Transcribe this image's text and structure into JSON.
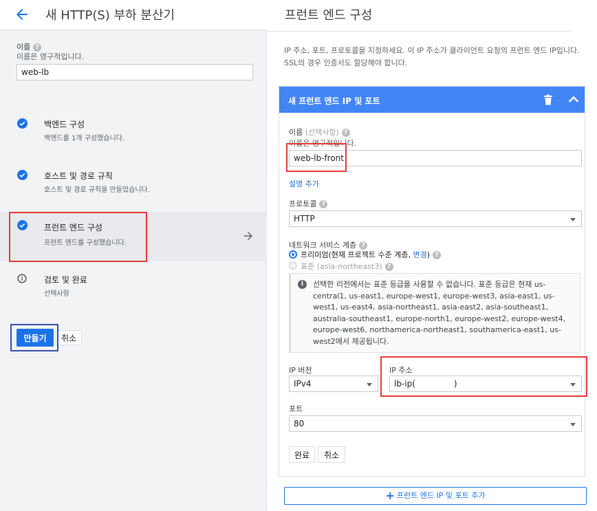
{
  "header": {
    "title": "새 HTTP(S) 부하 분산기"
  },
  "lb_name": {
    "label": "이름",
    "sublabel": "이름은 영구적입니다.",
    "value": "web-lb"
  },
  "steps": [
    {
      "title": "백엔드 구성",
      "description": "백엔드를 1개 구성했습니다."
    },
    {
      "title": "호스트 및 경로 규칙",
      "description": "호스트 및 경로 규칙을 만들었습니다."
    },
    {
      "title": "프런트 엔드 구성",
      "description": "프런트 엔드를 구성했습니다."
    },
    {
      "title": "검토 및 완료",
      "description": "선택사항"
    }
  ],
  "actions": {
    "create": "만들기",
    "cancel": "취소"
  },
  "frontend": {
    "title": "프런트 엔드 구성",
    "description": "IP 주소, 포트, 프로토콜을 지정하세요. 이 IP 주소가 클라이언트 요청의 프런트 엔드 IP입니다. SSL의 경우 인증서도 할당해야 합니다.",
    "card_title": "새 프런트 엔드 IP 및 포트",
    "name_label": "이름",
    "name_optional": "(선택사항)",
    "name_sublabel": "이름은 영구적입니다.",
    "name_value": "web-lb-front",
    "add_description": "설명 추가",
    "protocol_label": "프로토콜",
    "protocol_value": "HTTP",
    "tier_label": "네트워크 서비스 계층",
    "tier_premium": "프리미엄(현재 프로젝트 수준 계층,",
    "tier_change": "변경",
    "tier_premium_close": ")",
    "tier_standard": "표준 (asia-northeast3)",
    "notice": "선택한 리전에서는 표준 등급을 사용할 수 없습니다. 표준 등급은 현재 us-central1, us-east1, europe-west1, europe-west3, asia-east1, us-west1, us-east4, asia-northeast1, asia-east2, asia-southeast1, australia-southeast1, europe-north1, europe-west2, europe-west4, europe-west6, northamerica-northeast1, southamerica-east1, us-west2에서 제공됩니다.",
    "ip_version_label": "IP 버전",
    "ip_version_value": "IPv4",
    "ip_address_label": "IP 주소",
    "ip_address_value_prefix": "lb-ip(",
    "ip_address_value_suffix": ")",
    "port_label": "포트",
    "port_value": "80",
    "done": "완료",
    "cancel": "취소",
    "add_button": "프런트 엔드 IP 및 포트 추가"
  },
  "colors": {
    "accent": "#1a73e8",
    "card_header": "#4285f4",
    "highlight_red": "#e53935",
    "highlight_blue": "#3949ab"
  }
}
